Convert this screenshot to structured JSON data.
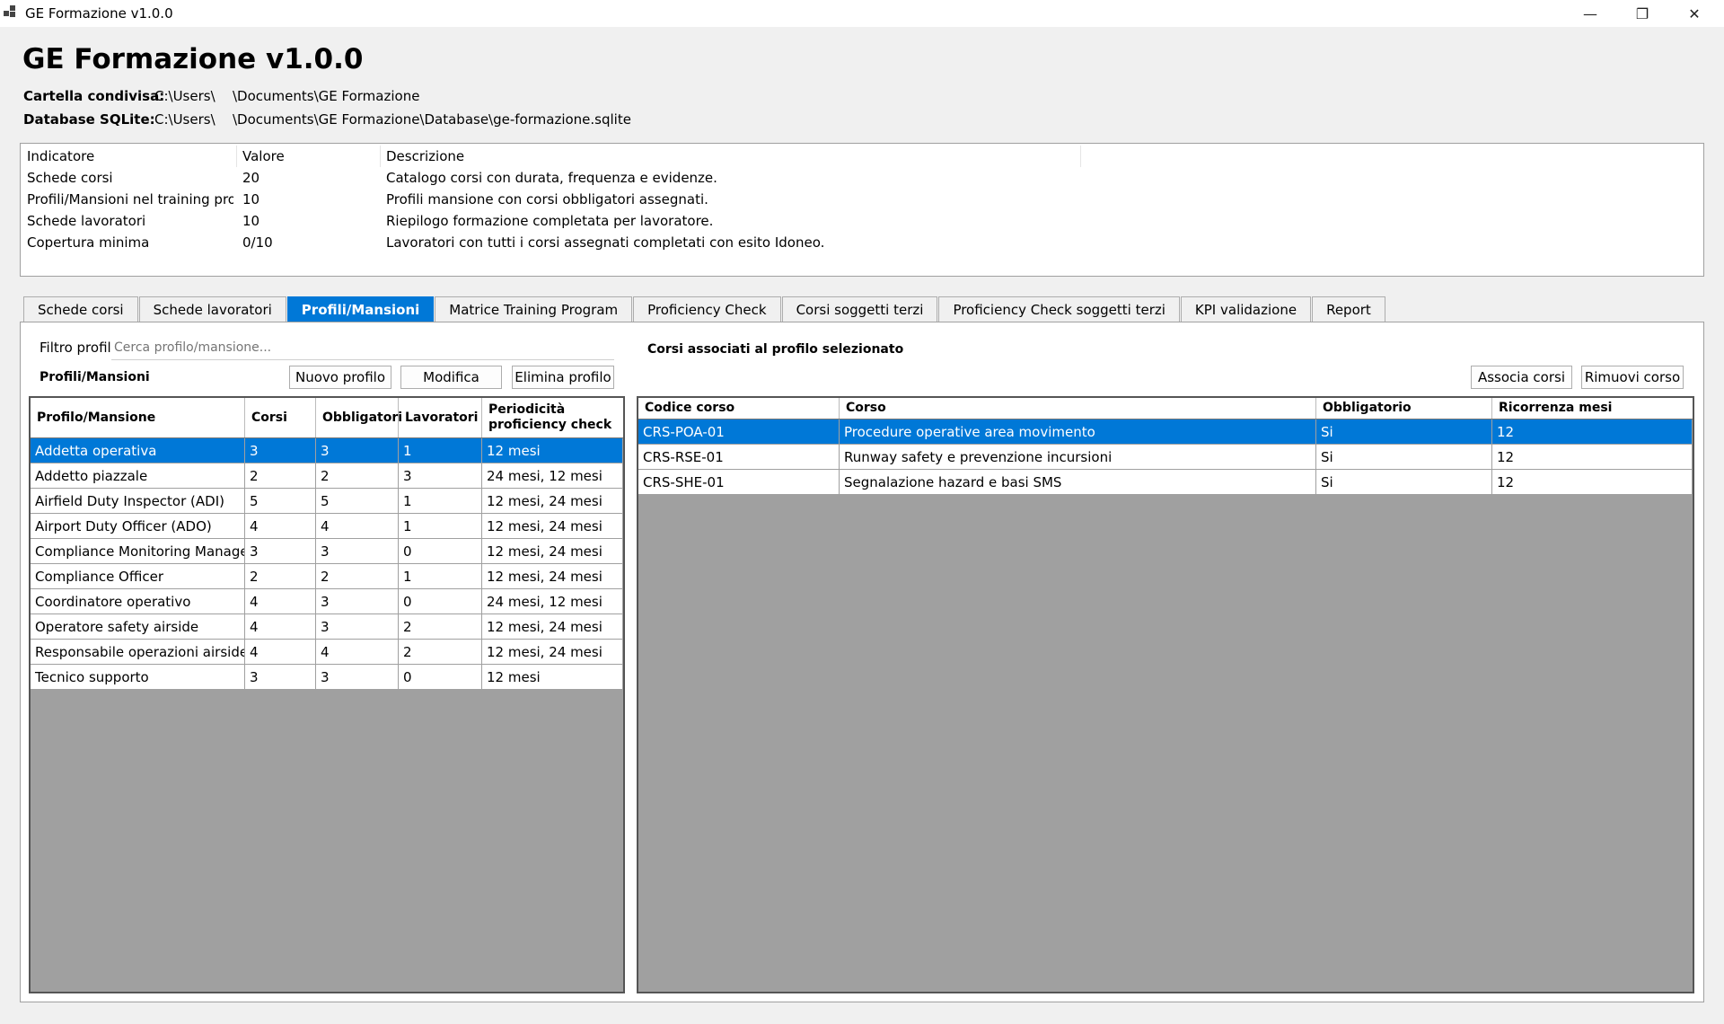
{
  "window": {
    "title": "GE Formazione v1.0.0",
    "minimize": "—",
    "restore": "❐",
    "close": "✕"
  },
  "header": {
    "title": "GE Formazione v1.0.0",
    "shared_folder_label": "Cartella condivisa:",
    "shared_folder_part1": "C:\\Users\\",
    "shared_folder_part2": "\\Documents\\GE Formazione",
    "database_label": "Database SQLite:",
    "database_part1": "C:\\Users\\",
    "database_part2": "\\Documents\\GE Formazione\\Database\\ge-formazione.sqlite"
  },
  "kpi": {
    "headers": [
      "Indicatore",
      "Valore",
      "Descrizione"
    ],
    "rows": [
      [
        "Schede corsi",
        "20",
        "Catalogo corsi con durata, frequenza e evidenze."
      ],
      [
        "Profili/Mansioni nel training prog...",
        "10",
        "Profili mansione con corsi obbligatori assegnati."
      ],
      [
        "Schede lavoratori",
        "10",
        "Riepilogo formazione completata per lavoratore."
      ],
      [
        "Copertura minima",
        "0/10",
        "Lavoratori con tutti i corsi assegnati completati con esito Idoneo."
      ]
    ]
  },
  "tabs": [
    "Schede corsi",
    "Schede lavoratori",
    "Profili/Mansioni",
    "Matrice Training Program",
    "Proficiency Check",
    "Corsi soggetti terzi",
    "Proficiency Check soggetti terzi",
    "KPI validazione",
    "Report"
  ],
  "active_tab": "Profili/Mansioni",
  "profiles": {
    "filter_label": "Filtro profili",
    "filter_placeholder": "Cerca profilo/mansione...",
    "section_title": "Profili/Mansioni",
    "new_button": "Nuovo profilo",
    "edit_button": "Modifica",
    "delete_button": "Elimina profilo",
    "columns": [
      "Profilo/Mansione",
      "Corsi",
      "Obbligatori",
      "Lavoratori",
      "Periodicità proficiency check"
    ],
    "rows": [
      [
        "Addetta operativa",
        "3",
        "3",
        "1",
        "12 mesi"
      ],
      [
        "Addetto piazzale",
        "2",
        "2",
        "3",
        "24 mesi, 12 mesi"
      ],
      [
        "Airfield Duty Inspector (ADI)",
        "5",
        "5",
        "1",
        "12 mesi, 24 mesi"
      ],
      [
        "Airport Duty Officer (ADO)",
        "4",
        "4",
        "1",
        "12 mesi, 24 mesi"
      ],
      [
        "Compliance Monitoring Manager",
        "3",
        "3",
        "0",
        "12 mesi, 24 mesi"
      ],
      [
        "Compliance Officer",
        "2",
        "2",
        "1",
        "12 mesi, 24 mesi"
      ],
      [
        "Coordinatore operativo",
        "4",
        "3",
        "0",
        "24 mesi, 12 mesi"
      ],
      [
        "Operatore safety airside",
        "4",
        "3",
        "2",
        "12 mesi, 24 mesi"
      ],
      [
        "Responsabile operazioni airside",
        "4",
        "4",
        "2",
        "12 mesi, 24 mesi"
      ],
      [
        "Tecnico supporto",
        "3",
        "3",
        "0",
        "12 mesi"
      ]
    ],
    "selected_row": 0
  },
  "courses": {
    "section_title": "Corsi associati al profilo selezionato",
    "associate_button": "Associa corsi",
    "remove_button": "Rimuovi corso",
    "columns": [
      "Codice corso",
      "Corso",
      "Obbligatorio",
      "Ricorrenza mesi"
    ],
    "rows": [
      [
        "CRS-POA-01",
        "Procedure operative area movimento",
        "Si",
        "12"
      ],
      [
        "CRS-RSE-01",
        "Runway safety e prevenzione incursioni",
        "Si",
        "12"
      ],
      [
        "CRS-SHE-01",
        "Segnalazione hazard e basi SMS",
        "Si",
        "12"
      ]
    ],
    "selected_row": 0
  }
}
